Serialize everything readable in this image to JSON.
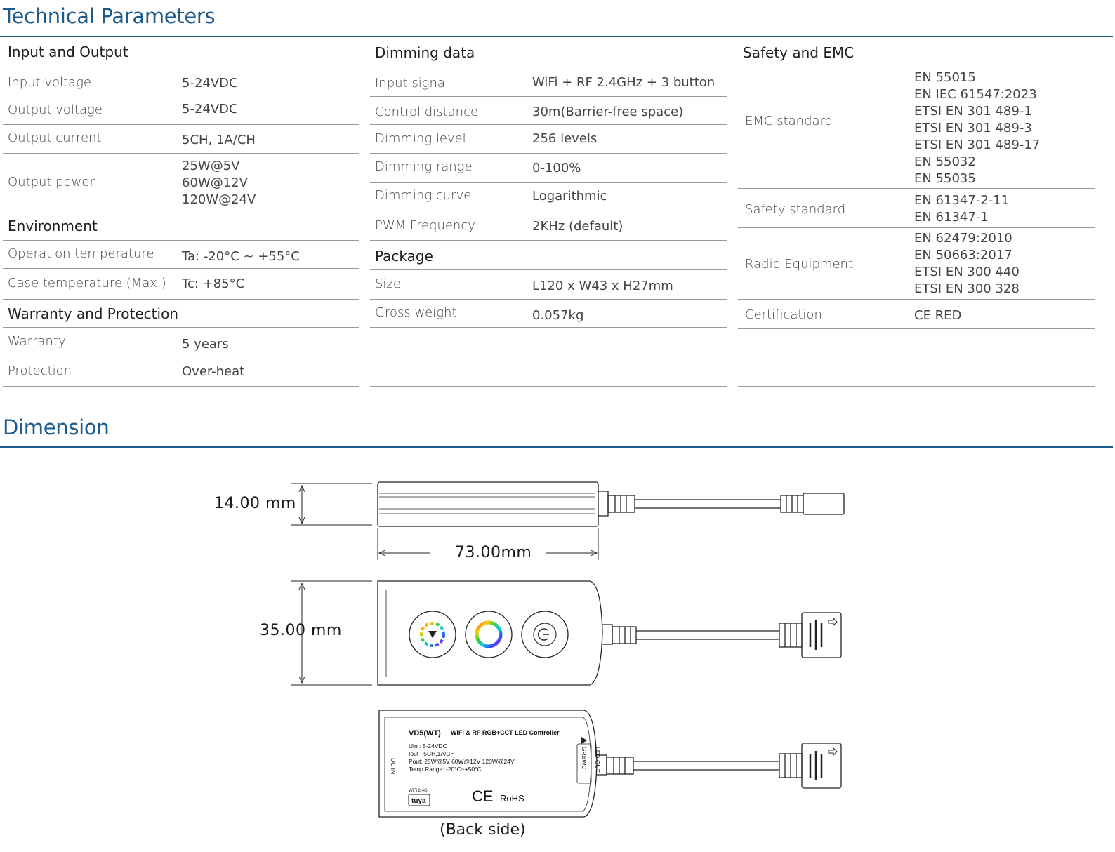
{
  "sections": {
    "technical_title": "Technical Parameters",
    "dimension_title": "Dimension"
  },
  "col1": {
    "input_output": {
      "title": "Input and Output",
      "rows": [
        {
          "label": "Input voltage",
          "values": [
            "5-24VDC"
          ]
        },
        {
          "label": "Output voltage",
          "values": [
            "5-24VDC"
          ]
        },
        {
          "label": "Output current",
          "values": [
            "5CH, 1A/CH"
          ]
        },
        {
          "label": "Output power",
          "values": [
            "25W@5V",
            "60W@12V",
            "120W@24V"
          ]
        }
      ]
    },
    "environment": {
      "title": "Environment",
      "rows": [
        {
          "label": "Operation temperature",
          "values": [
            "Ta: -20°C ~ +55°C"
          ]
        },
        {
          "label": "Case temperature (Max.)",
          "values": [
            "Tc: +85°C"
          ]
        }
      ]
    },
    "warranty": {
      "title": "Warranty and Protection",
      "rows": [
        {
          "label": "Warranty",
          "values": [
            "5 years"
          ]
        },
        {
          "label": "Protection",
          "values": [
            "Over-heat"
          ]
        }
      ]
    }
  },
  "col2": {
    "dimming": {
      "title": "Dimming data",
      "rows": [
        {
          "label": "Input signal",
          "values": [
            "WiFi + RF 2.4GHz + 3 button"
          ]
        },
        {
          "label": "Control distance",
          "values": [
            "30m(Barrier-free space)"
          ]
        },
        {
          "label": "Dimming level",
          "values": [
            "256 levels"
          ]
        },
        {
          "label": "Dimming range",
          "values": [
            "0-100%"
          ]
        },
        {
          "label": "Dimming curve",
          "values": [
            "Logarithmic"
          ]
        },
        {
          "label": "PWM Frequency",
          "values": [
            "2KHz (default)"
          ]
        }
      ]
    },
    "package": {
      "title": "Package",
      "rows": [
        {
          "label": "Size",
          "values": [
            "L120 x W43 x H27mm"
          ]
        },
        {
          "label": "Gross weight",
          "values": [
            "0.057kg"
          ]
        }
      ]
    }
  },
  "col3": {
    "safety": {
      "title": "Safety and EMC",
      "rows": [
        {
          "label": "EMC standard",
          "values": [
            "EN 55015",
            "EN IEC 61547:2023",
            "ETSI EN 301 489-1",
            "ETSI EN 301 489-3",
            "ETSI EN 301 489-17",
            "EN 55032",
            "EN 55035"
          ]
        },
        {
          "label": "Safety standard",
          "values": [
            "EN 61347-2-11",
            "EN 61347-1"
          ]
        },
        {
          "label": "Radio Equipment",
          "values": [
            "EN 62479:2010",
            "EN 50663:2017",
            "ETSI EN 300 440",
            "ETSI EN 300 328"
          ]
        },
        {
          "label": "Certification",
          "values": [
            "CE RED"
          ]
        }
      ]
    }
  },
  "dimension": {
    "height_side": "14.00 mm",
    "length": "73.00mm",
    "width_top": "35.00 mm",
    "back_caption": "(Back side)",
    "label_model": "VD5(WT)",
    "label_desc": "WiFi & RF RGB+CCT LED Controller",
    "label_uin": "Uin : 5-24VDC",
    "label_iout": "Iout : 5CH,1A/CH",
    "label_pout": "Pout: 25W@5V  60W@12V  120W@24V",
    "label_temp": "Temp Range: -20°C~+50°C",
    "label_dcin": "DC IN",
    "label_ledout": "LED OUT",
    "label_grbwc": "GRBWC",
    "label_wifi": "WiFi 2.4G",
    "label_tuya": "tuya",
    "label_ce": "CE",
    "label_rohs": "RoHS"
  }
}
